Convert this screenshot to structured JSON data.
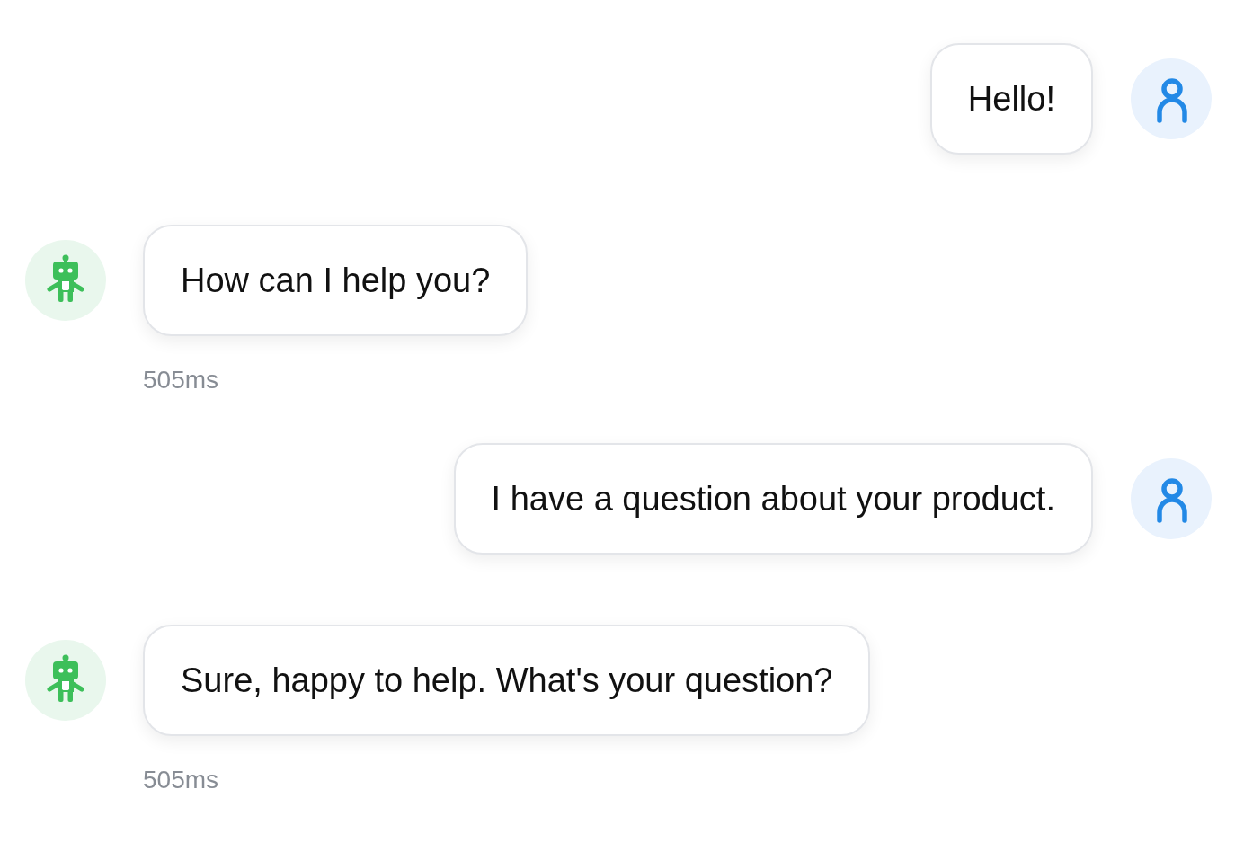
{
  "messages": [
    {
      "kind": "user",
      "text": "Hello!"
    },
    {
      "kind": "bot",
      "text": "How can I help you?",
      "latency": "505ms"
    },
    {
      "kind": "user",
      "text": "I have a question about your product."
    },
    {
      "kind": "bot",
      "text": "Sure, happy to help. What's your question?",
      "latency": "505ms"
    }
  ]
}
